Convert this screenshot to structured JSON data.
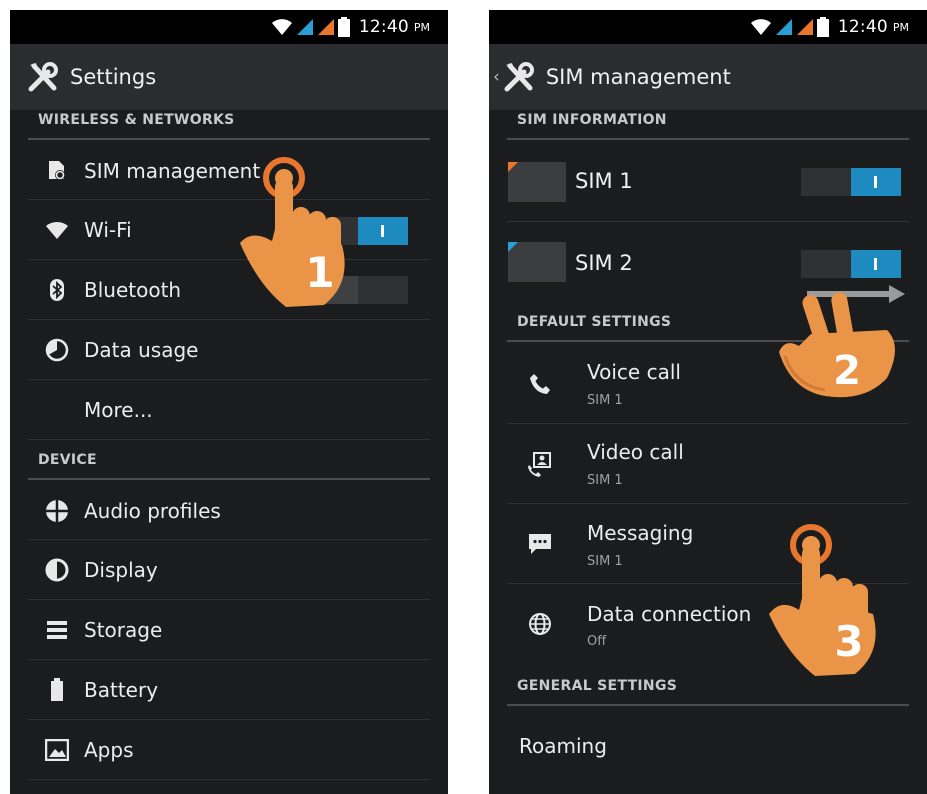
{
  "status_bar": {
    "time": "12:40",
    "ampm": "PM"
  },
  "left": {
    "title": "Settings",
    "sections": {
      "wireless": "WIRELESS & NETWORKS",
      "device": "DEVICE"
    },
    "items": {
      "sim": "SIM management",
      "wifi": "Wi-Fi",
      "bluetooth": "Bluetooth",
      "data_usage": "Data usage",
      "more": "More...",
      "audio": "Audio profiles",
      "display": "Display",
      "storage": "Storage",
      "battery": "Battery",
      "apps": "Apps"
    },
    "wifi_on": true,
    "bluetooth_on": false,
    "step": "1"
  },
  "right": {
    "title": "SIM management",
    "sections": {
      "sim_info": "SIM INFORMATION",
      "default": "DEFAULT SETTINGS",
      "general": "GENERAL SETTINGS"
    },
    "sims": [
      {
        "label": "SIM 1",
        "color": "#e8762d",
        "on": true
      },
      {
        "label": "SIM 2",
        "color": "#2a9fd6",
        "on": true
      }
    ],
    "defaults": [
      {
        "title": "Voice call",
        "sub": "SIM 1",
        "icon": "phone-icon"
      },
      {
        "title": "Video call",
        "sub": "SIM 1",
        "icon": "video-call-icon"
      },
      {
        "title": "Messaging",
        "sub": "SIM 1",
        "icon": "message-icon"
      },
      {
        "title": "Data connection",
        "sub": "Off",
        "icon": "globe-icon"
      }
    ],
    "general": {
      "roaming": "Roaming"
    },
    "step2": "2",
    "step3": "3"
  },
  "colors": {
    "accent_blue": "#1e8bc0",
    "hand_orange": "#ea9448",
    "background": "#1b1c1e"
  }
}
